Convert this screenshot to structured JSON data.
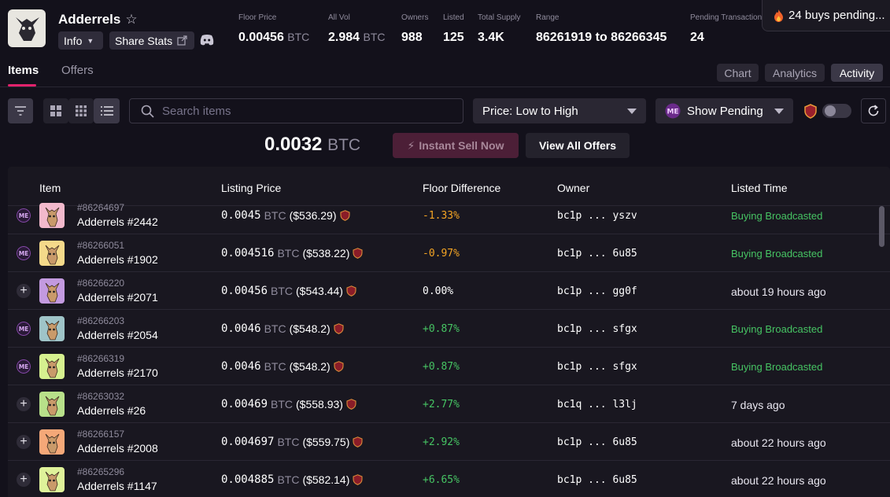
{
  "collection": {
    "name": "Adderrels",
    "info_label": "Info",
    "share_label": "Share Stats"
  },
  "stats": [
    {
      "label": "Floor Price",
      "value": "0.00456",
      "unit": "BTC"
    },
    {
      "label": "All Vol",
      "value": "2.984",
      "unit": "BTC"
    },
    {
      "label": "Owners",
      "value": "988",
      "unit": ""
    },
    {
      "label": "Listed",
      "value": "125",
      "unit": ""
    },
    {
      "label": "Total Supply",
      "value": "3.4K",
      "unit": ""
    },
    {
      "label": "Range",
      "value": "86261919 to 86266345",
      "unit": ""
    },
    {
      "label": "Pending Transactions",
      "value": "24",
      "unit": ""
    }
  ],
  "pending_banner": "24 buys pending...",
  "tabs": [
    "Items",
    "Offers"
  ],
  "view_tabs": [
    "Chart",
    "Analytics",
    "Activity"
  ],
  "toolbar": {
    "search_placeholder": "Search items",
    "sort_value": "Price: Low to High",
    "pending_value": "Show Pending"
  },
  "sell": {
    "price": "0.0032",
    "unit": "BTC",
    "instant_sell_label": "Instant Sell Now",
    "view_offers_label": "View All Offers"
  },
  "table": {
    "headers": [
      "Item",
      "Listing Price",
      "Floor Difference",
      "Owner",
      "Listed Time"
    ],
    "rows": [
      {
        "icon": "me",
        "inscription": "#86264697",
        "name": "Adderrels #2442",
        "price": "0.0045",
        "unit": "BTC",
        "usd": "($536.29)",
        "diff": "-1.33%",
        "owner": "bc1p ... yszv",
        "time": "Buying Broadcasted",
        "thumb": "#f2b9cc"
      },
      {
        "icon": "me",
        "inscription": "#86266051",
        "name": "Adderrels #1902",
        "price": "0.004516",
        "unit": "BTC",
        "usd": "($538.22)",
        "diff": "-0.97%",
        "owner": "bc1p ... 6u85",
        "time": "Buying Broadcasted",
        "thumb": "#f4d98a"
      },
      {
        "icon": "plus",
        "inscription": "#86266220",
        "name": "Adderrels #2071",
        "price": "0.00456",
        "unit": "BTC",
        "usd": "($543.44)",
        "diff": "0.00%",
        "owner": "bc1p ... gg0f",
        "time": "about 19 hours ago",
        "thumb": "#c39ae0"
      },
      {
        "icon": "me",
        "inscription": "#86266203",
        "name": "Adderrels #2054",
        "price": "0.0046",
        "unit": "BTC",
        "usd": "($548.2)",
        "diff": "+0.87%",
        "owner": "bc1p ... sfgx",
        "time": "Buying Broadcasted",
        "thumb": "#9fc4c8"
      },
      {
        "icon": "me",
        "inscription": "#86266319",
        "name": "Adderrels #2170",
        "price": "0.0046",
        "unit": "BTC",
        "usd": "($548.2)",
        "diff": "+0.87%",
        "owner": "bc1p ... sfgx",
        "time": "Buying Broadcasted",
        "thumb": "#d6f08f"
      },
      {
        "icon": "plus",
        "inscription": "#86263032",
        "name": "Adderrels #26",
        "price": "0.00469",
        "unit": "BTC",
        "usd": "($558.93)",
        "diff": "+2.77%",
        "owner": "bc1q ... l3lj",
        "time": "7 days ago",
        "thumb": "#b8e08a"
      },
      {
        "icon": "plus",
        "inscription": "#86266157",
        "name": "Adderrels #2008",
        "price": "0.004697",
        "unit": "BTC",
        "usd": "($559.75)",
        "diff": "+2.92%",
        "owner": "bc1p ... 6u85",
        "time": "about 22 hours ago",
        "thumb": "#f5a878"
      },
      {
        "icon": "plus",
        "inscription": "#86265296",
        "name": "Adderrels #1147",
        "price": "0.004885",
        "unit": "BTC",
        "usd": "($582.14)",
        "diff": "+6.65%",
        "owner": "bc1p ... 6u85",
        "time": "about 22 hours ago",
        "thumb": "#dff29a"
      }
    ]
  },
  "colors": {
    "accent": "#e2226c",
    "negative": "#f5a524",
    "positive": "#46c463",
    "neutral": "#ffffff"
  }
}
